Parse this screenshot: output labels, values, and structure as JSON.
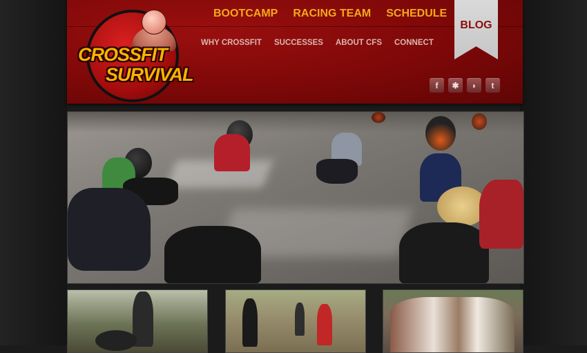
{
  "logo": {
    "line1": "CROSSFIT",
    "line2": "SURVIVAL"
  },
  "nav": {
    "primary": [
      "BOOTCAMP",
      "RACING TEAM",
      "SCHEDULE"
    ],
    "secondary": [
      "WHY CROSSFIT",
      "SUCCESSES",
      "ABOUT CFS",
      "CONNECT"
    ]
  },
  "blog": {
    "label": "BLOG"
  },
  "social": [
    {
      "icon": "facebook-icon",
      "glyph": "f"
    },
    {
      "icon": "yelp-icon",
      "glyph": "✱"
    },
    {
      "icon": "rss-icon",
      "glyph": "◗"
    },
    {
      "icon": "twitter-icon",
      "glyph": "t"
    }
  ],
  "colors": {
    "header_red": "#8a0d0d",
    "nav_gold": "#f3a91a",
    "secondary_nav": "#d8b7b0",
    "background": "#1b1b1b"
  }
}
